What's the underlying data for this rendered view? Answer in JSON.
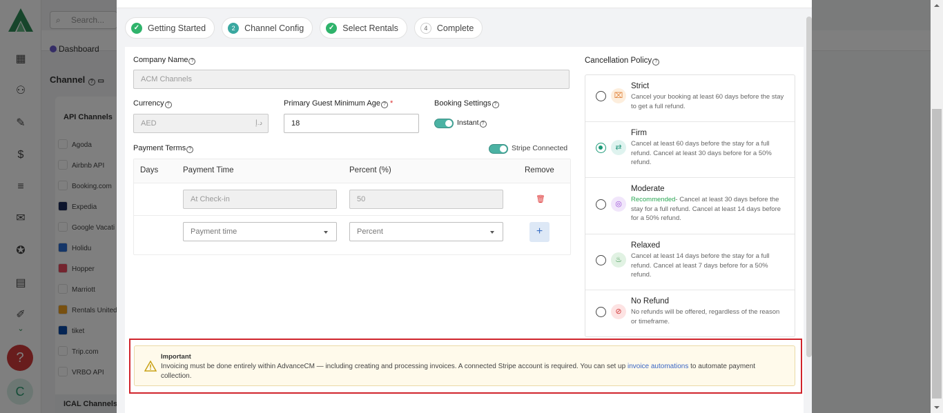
{
  "background": {
    "search_placeholder": "Search...",
    "dashboard_crumb": "Dashboard",
    "channel_title": "Channel",
    "api_channels_heading": "API Channels",
    "ical_channels_heading": "ICAL Channels",
    "channels": [
      {
        "name": "Agoda",
        "icon": "agoda-icon",
        "color": "#ffffff"
      },
      {
        "name": "Airbnb API",
        "icon": "airbnb-icon",
        "color": "#ffffff"
      },
      {
        "name": "Booking.com",
        "icon": "booking-icon",
        "color": "#ffffff"
      },
      {
        "name": "Expedia",
        "icon": "expedia-icon",
        "color": "#1a2a5a"
      },
      {
        "name": "Google Vacati",
        "icon": "google-vacation-icon",
        "color": "#ffffff"
      },
      {
        "name": "Holidu",
        "icon": "holidu-icon",
        "color": "#2b6cd1"
      },
      {
        "name": "Hopper",
        "icon": "hopper-icon",
        "color": "#e84a5f"
      },
      {
        "name": "Marriott",
        "icon": "marriott-icon",
        "color": "#ffffff"
      },
      {
        "name": "Rentals United",
        "icon": "rentals-united-icon",
        "color": "#f0a020"
      },
      {
        "name": "tiket",
        "icon": "tiket-icon",
        "color": "#0a4aa8"
      },
      {
        "name": "Trip.com",
        "icon": "trip-icon",
        "color": "#ffffff"
      },
      {
        "name": "VRBO API",
        "icon": "vrbo-icon",
        "color": "#ffffff"
      }
    ],
    "help_label": "?",
    "avatar_initial": "C"
  },
  "steps": [
    {
      "label": "Getting Started",
      "state": "done",
      "marker": "✓"
    },
    {
      "label": "Channel Config",
      "state": "active",
      "marker": "2"
    },
    {
      "label": "Select Rentals",
      "state": "done",
      "marker": "✓"
    },
    {
      "label": "Complete",
      "state": "pending",
      "marker": "4"
    }
  ],
  "form": {
    "company_name_label": "Company Name",
    "company_name_value": "ACM Channels",
    "currency_label": "Currency",
    "currency_value": "AED",
    "currency_symbol": "د.إ",
    "min_age_label": "Primary Guest Minimum Age",
    "min_age_value": "18",
    "booking_settings_label": "Booking Settings",
    "instant_label": "Instant",
    "payment_terms_label": "Payment Terms",
    "stripe_label": "Stripe Connected"
  },
  "payment_table": {
    "headers": [
      "Days",
      "Payment Time",
      "Percent (%)",
      "Remove"
    ],
    "rows": [
      {
        "payment_time": "At Check-in",
        "percent": "50"
      }
    ],
    "new_row": {
      "payment_time_placeholder": "Payment time",
      "percent_placeholder": "Percent"
    },
    "add_label": "+"
  },
  "cancellation": {
    "label": "Cancellation Policy",
    "selected": "Firm",
    "options": [
      {
        "title": "Strict",
        "desc": "Cancel your booking at least 60 days before the stay to get a full refund.",
        "icon": "calendar-cancel-icon",
        "icon_bg": "#fdeedd",
        "icon_color": "#e0823a",
        "recommended": ""
      },
      {
        "title": "Firm",
        "desc": "Cancel at least 60 days before the stay for a full refund. Cancel at least 30 days before for a 50% refund.",
        "icon": "money-refund-icon",
        "icon_bg": "#dff3ef",
        "icon_color": "#2a9a80",
        "recommended": ""
      },
      {
        "title": "Moderate",
        "desc": "- Cancel at least 30 days before the stay for a full refund. Cancel at least 14 days before for a 50% refund.",
        "icon": "balance-icon",
        "icon_bg": "#f1e6fb",
        "icon_color": "#9a4fd6",
        "recommended": "Recommended"
      },
      {
        "title": "Relaxed",
        "desc": "Cancel at least 14 days before the stay for a full refund. Cancel at least 7 days before for a 50% refund.",
        "icon": "lounge-chair-icon",
        "icon_bg": "#e1f2e3",
        "icon_color": "#2e8a40",
        "recommended": ""
      },
      {
        "title": "No Refund",
        "desc": "No refunds will be offered, regardless of the reason or timeframe.",
        "icon": "no-refund-icon",
        "icon_bg": "#fde3e3",
        "icon_color": "#d23a3a",
        "recommended": ""
      }
    ]
  },
  "important": {
    "title": "Important",
    "text_before": "Invoicing must be done entirely within AdvanceCM — including creating and processing invoices. A connected Stripe account is required. You can set up",
    "link": "invoice automations",
    "text_after": "to automate payment collection."
  },
  "colors": {
    "accent": "#4bb2a3",
    "done_green": "#2fb36b",
    "danger": "#d33",
    "highlight_border": "#d0232b"
  }
}
